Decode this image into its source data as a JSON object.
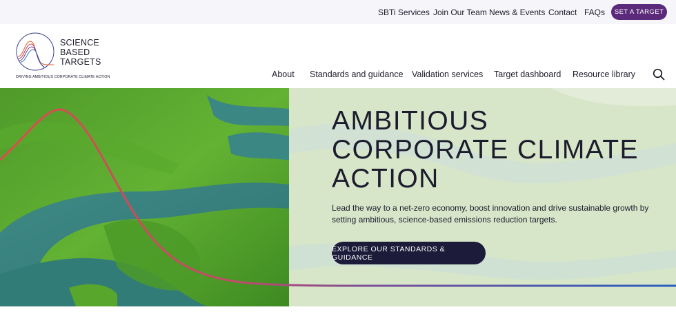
{
  "topbar": {
    "links": [
      "SBTi Services",
      "Join Our Team",
      "News & Events",
      "Contact",
      "FAQs"
    ],
    "cta": "SET A TARGET"
  },
  "logo": {
    "line1": "SCIENCE",
    "line2": "BASED",
    "line3": "TARGETS",
    "tagline": "DRIVING AMBITIOUS CORPORATE CLIMATE ACTION"
  },
  "nav": {
    "items": [
      "About",
      "Standards and guidance",
      "Validation services",
      "Target dashboard",
      "Resource library"
    ],
    "search_icon": "search-icon"
  },
  "hero": {
    "title_lines": [
      "AMBITIOUS",
      "CORPORATE CLIMATE",
      "ACTION"
    ],
    "subtitle": "Lead the way to a net-zero economy, boost innovation and drive sustainable growth by setting ambitious, science-based emissions reduction targets.",
    "cta": "EXPLORE OUR STANDARDS & GUIDANCE"
  },
  "colors": {
    "accent_purple": "#5c2a7a",
    "hero_button": "#1c1c3a",
    "curve_red": "#d8504a",
    "curve_blue": "#2a5fc0"
  }
}
